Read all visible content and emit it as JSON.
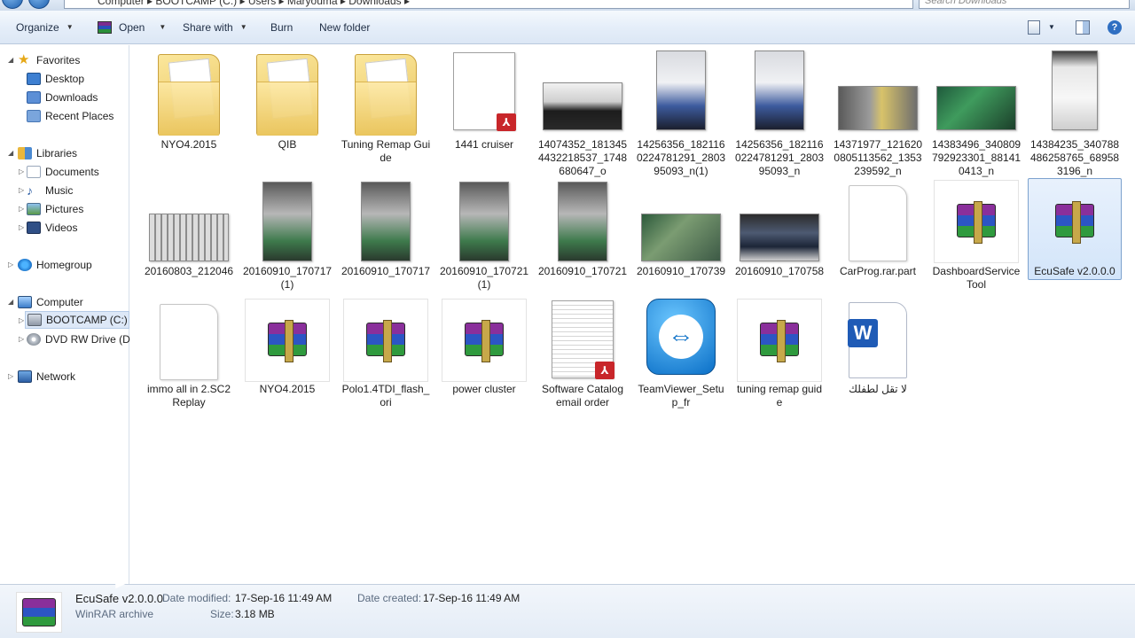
{
  "address": {
    "path": "Computer  ▸  BOOTCAMP (C:)  ▸  Users  ▸  Maryouma  ▸  Downloads  ▸",
    "search_placeholder": "Search Downloads"
  },
  "toolbar": {
    "organize": "Organize",
    "open": "Open",
    "share_with": "Share with",
    "burn": "Burn",
    "new_folder": "New folder"
  },
  "nav": {
    "favorites": "Favorites",
    "desktop": "Desktop",
    "downloads": "Downloads",
    "recent_places": "Recent Places",
    "libraries": "Libraries",
    "documents": "Documents",
    "music": "Music",
    "pictures": "Pictures",
    "videos": "Videos",
    "homegroup": "Homegroup",
    "computer": "Computer",
    "bootcamp": "BOOTCAMP (C:)",
    "dvd": "DVD RW Drive (D:",
    "network": "Network"
  },
  "files": {
    "f1": "NYO4.2015",
    "f2": "QIB",
    "f3": "Tuning Remap Guide",
    "f4": "1441 cruiser",
    "f5": "14074352_1813454432218537_1748680647_o",
    "f6": "14256356_1821160224781291_280395093_n(1)",
    "f7": "14256356_1821160224781291_280395093_n",
    "f8": "14371977_1216200805113562_1353239592_n",
    "f9": "14383496_340809792923301_881410413_n",
    "f10": "14384235_340788486258765_689583196_n",
    "f11": "20160803_212046",
    "f12": "20160910_170717(1)",
    "f13": "20160910_170717",
    "f14": "20160910_170721(1)",
    "f15": "20160910_170721",
    "f16": "20160910_170739",
    "f17": "20160910_170758",
    "f18": "CarProg.rar.part",
    "f19": "DashboardServiceTool",
    "f20": "EcuSafe v2.0.0.0",
    "f21": "immo all in 2.SC2Replay",
    "f22": "NYO4.2015",
    "f23": "Polo1.4TDI_flash_ori",
    "f24": "power cluster",
    "f25": "Software Catalog email order",
    "f26": "TeamViewer_Setup_fr",
    "f27": "tuning remap guide",
    "f28": "لا تقل لطفلك"
  },
  "details": {
    "name": "EcuSafe v2.0.0.0",
    "type": "WinRAR archive",
    "date_modified_label": "Date modified:",
    "date_modified": "17-Sep-16 11:49 AM",
    "size_label": "Size:",
    "size": "3.18 MB",
    "date_created_label": "Date created:",
    "date_created": "17-Sep-16 11:49 AM"
  },
  "colors": {
    "toolbar_bg": "#dce7f5",
    "selection": "#d3e5fa",
    "selection_border": "#7da2ce",
    "winrar_purple": "#8a2f9b",
    "winrar_blue": "#2c55c4",
    "winrar_green": "#2f9a3e",
    "pdf_red": "#c8262a",
    "teamviewer_blue": "#0a6fc7"
  }
}
